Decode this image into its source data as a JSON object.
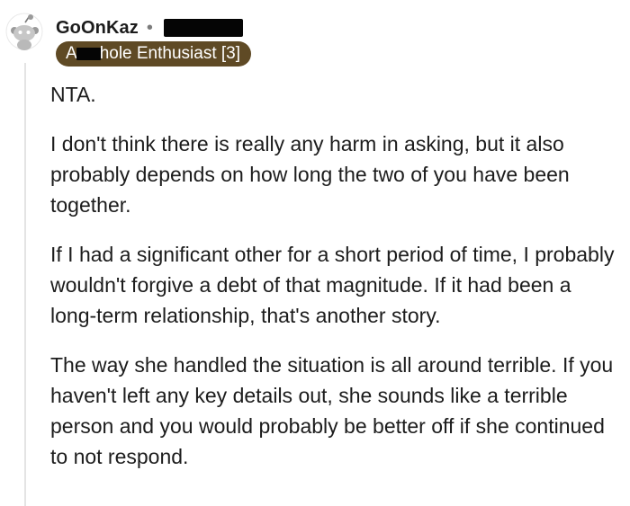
{
  "comment": {
    "author": {
      "username": "GoOnKaz",
      "separator": "•",
      "flair": {
        "prefix": "A",
        "suffix": "hole Enthusiast [3]",
        "color": "#5f4a25"
      }
    },
    "paragraphs": [
      "NTA.",
      "I don't think there is really any harm in asking, but it also probably depends on how long the two of you have been together.",
      "If I had a significant other for a short period of time, I probably wouldn't forgive a debt of that magnitude. If it had been a long-term relationship, that's another story.",
      "The way she handled the situation is all around terrible. If you haven't left any key details out, she sounds like a terrible person and you would probably be better off if she continued to not respond."
    ]
  },
  "icons": {
    "avatar": "snoo-avatar-icon"
  }
}
